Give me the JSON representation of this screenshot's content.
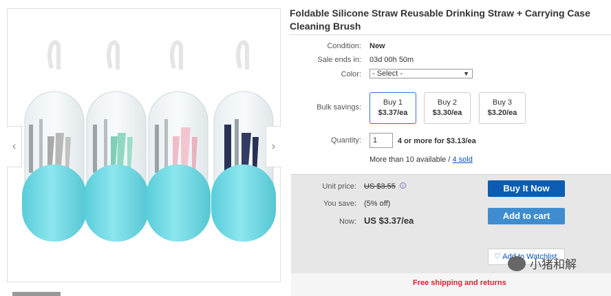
{
  "product": {
    "title": "Foldable Silicone Straw Reusable Drinking Straw + Carrying Case Cleaning Brush"
  },
  "specs": {
    "condition_label": "Condition:",
    "condition_value": "New",
    "sale_label": "Sale ends in:",
    "sale_value": "03d 00h 50m",
    "color_label": "Color:",
    "color_value": "- Select -",
    "bulk_label": "Bulk savings:",
    "bulk_options": [
      {
        "label": "Buy 1",
        "price": "$3.37/ea"
      },
      {
        "label": "Buy 2",
        "price": "$3.30/ea"
      },
      {
        "label": "Buy 3",
        "price": "$3.20/ea"
      }
    ],
    "quantity_label": "Quantity:",
    "quantity_value": "1",
    "quantity_offer": "4 or more for $3.13/ea",
    "availability": "More than 10 available / ",
    "sold_link": "4 sold"
  },
  "buybox": {
    "unit_price_label": "Unit price:",
    "unit_price_value": "US $3.55",
    "save_label": "You save:",
    "save_value": "(5% off)",
    "now_label": "Now:",
    "now_value": "US $3.37/ea",
    "buy_now": "Buy It Now",
    "add_to_cart": "Add to cart",
    "watchlist": "♡ Add to Watchlist",
    "shipping": "Free shipping and returns"
  },
  "watermark": {
    "text": "小猪和解"
  },
  "gallery": {
    "prev_icon": "chevron-left-icon",
    "next_icon": "chevron-right-icon"
  },
  "colors": {
    "accent_blue": "#0c5cb1",
    "cart_blue": "#3f8dcf",
    "shipping_red": "#dd1e31",
    "case_teal": "#6fd8e3"
  }
}
